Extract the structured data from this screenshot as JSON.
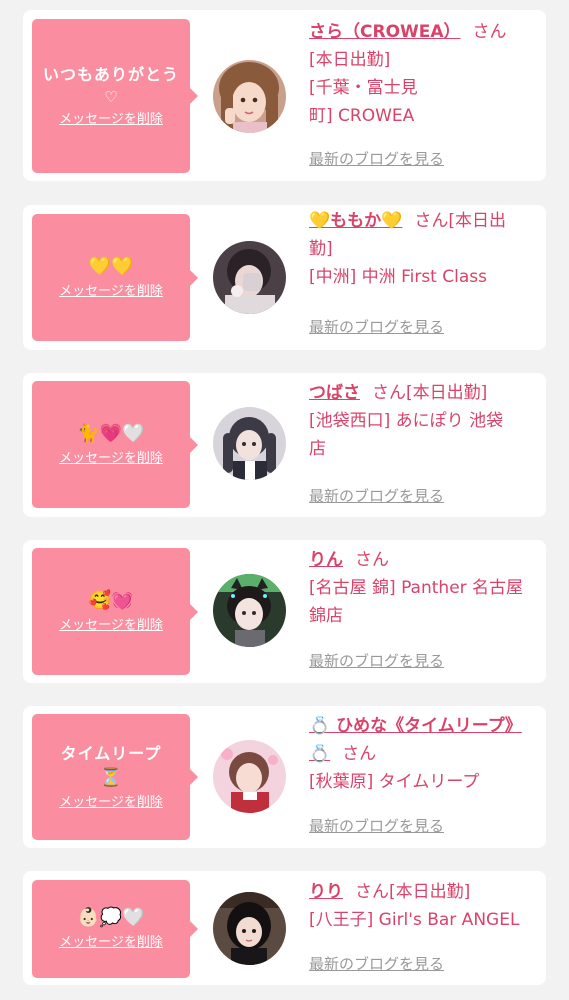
{
  "colors": {
    "card_bg": "#ffffff",
    "page_bg": "#f2f2f2",
    "bubble_bg": "#fa8ea0",
    "accent": "#d9436a",
    "muted": "#999999"
  },
  "delete_label": "メッセージを削除",
  "blog_label": "最新のブログを見る",
  "san_label": "さん",
  "items": [
    {
      "message": "いつもありがとう",
      "message_extra": "♡",
      "name": "さら（CROWEA）",
      "details": "[本日出勤]\n[千葉・富士見\n町] CROWEA",
      "avatar_icon": "girl-photo-peace"
    },
    {
      "message": "💛💛",
      "name": "💛ももか💛",
      "details": "[本日出\n勤]\n[中洲] 中洲 First Class",
      "avatar_icon": "girl-photo-dark"
    },
    {
      "message": "🐈💗🤍",
      "name": "つばさ",
      "details": "[本日出勤]\n[池袋西口] あにぽり 池袋\n店",
      "avatar_icon": "girl-photo-twintail"
    },
    {
      "message": "🥰💓",
      "name": "りん",
      "details": "\n[名古屋 錦] Panther 名古屋\n錦店",
      "avatar_icon": "girl-photo-cat-ears"
    },
    {
      "message": "タイムリープ",
      "message_extra": "⏳",
      "name": "💍 ひめな《タイムリープ》💍",
      "details": "[秋葉原] タイムリープ",
      "avatar_icon": "girl-photo-pink"
    },
    {
      "message": "👶🏻💭🤍",
      "name": "りり",
      "details": "[本日出勤]\n[八王子] Girl's Bar ANGEL",
      "avatar_icon": "girl-photo-black-hair"
    }
  ]
}
